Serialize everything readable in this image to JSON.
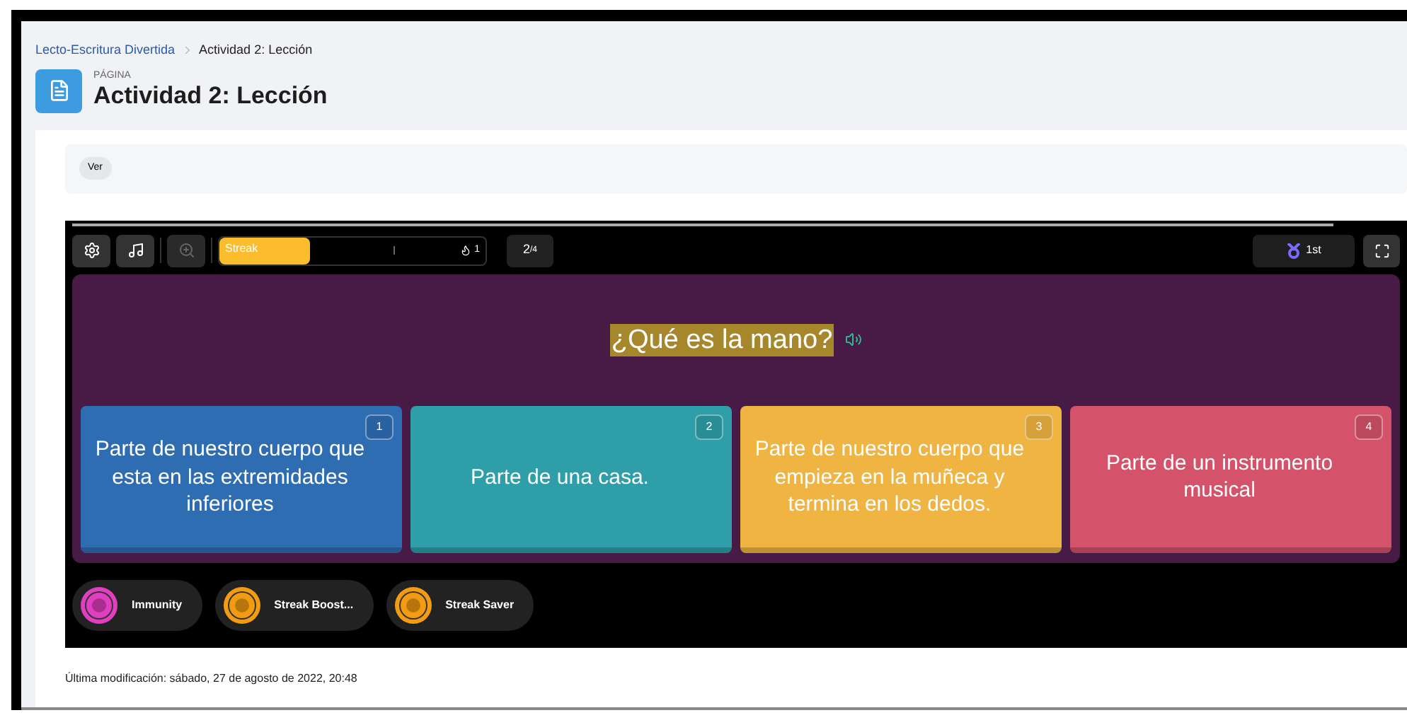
{
  "breadcrumb": [
    {
      "label": "Lecto-Escritura Divertida",
      "kind": "link"
    },
    {
      "label": "Actividad 2: Lección",
      "kind": "current"
    }
  ],
  "page": {
    "kicker": "PÁGINA",
    "title": "Actividad 2: Lección"
  },
  "view_button": "Ver",
  "game": {
    "progress": {
      "level": 0.95
    },
    "toolbar": {
      "streak": {
        "label": "Streak",
        "level": 0.34,
        "count": "1"
      },
      "question_counter": {
        "current": "2",
        "total": "/4"
      },
      "rank": "1st"
    },
    "question": "¿Qué es la mano?",
    "answers": [
      {
        "number": "1",
        "text": "Parte de nuestro cuerpo que esta en las extremidades inferiores",
        "color": "#2f6db3"
      },
      {
        "number": "2",
        "text": "Parte de una casa.",
        "color": "#2e9ea8"
      },
      {
        "number": "3",
        "text": "Parte de nuestro cuerpo que empieza en la muñeca y termina en los dedos.",
        "color": "#efb441"
      },
      {
        "number": "4",
        "text": "Parte de un instrumento musical",
        "color": "#d4526a"
      }
    ],
    "powerups": [
      {
        "label": "Immunity",
        "color": "#e03fc0"
      },
      {
        "label": "Streak Boost...",
        "color": "#f39c12"
      },
      {
        "label": "Streak Saver",
        "color": "#f39c12"
      }
    ]
  },
  "footer": "Última modificación: sábado, 27 de agosto de 2022, 20:48"
}
